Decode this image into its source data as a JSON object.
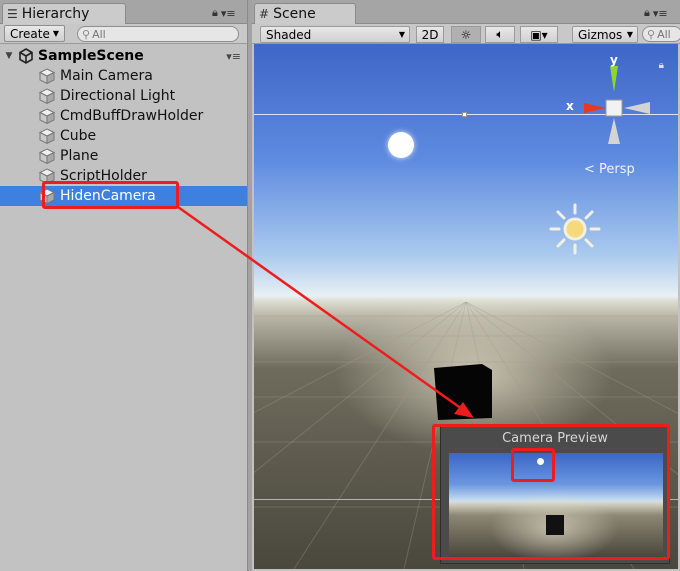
{
  "hierarchy": {
    "tab_label": "Hierarchy",
    "create_label": "Create",
    "search_placeholder": "All",
    "scene_name": "SampleScene",
    "items": [
      {
        "label": "Main Camera"
      },
      {
        "label": "Directional Light"
      },
      {
        "label": "CmdBuffDrawHolder"
      },
      {
        "label": "Cube"
      },
      {
        "label": "Plane"
      },
      {
        "label": "ScriptHolder"
      },
      {
        "label": "HidenCamera",
        "selected": true
      }
    ]
  },
  "scene": {
    "tab_label": "Scene",
    "shading_mode": "Shaded",
    "mode_2d_label": "2D",
    "gizmos_label": "Gizmos",
    "search_placeholder": "All",
    "projection_label": "Persp",
    "axis_x_label": "x",
    "axis_y_label": "y",
    "camera_preview_title": "Camera Preview"
  },
  "icons": {
    "hierarchy_tab": "list-icon",
    "scene_tab": "grid-icon",
    "lighting_toggle": "sun-icon",
    "audio_toggle": "speaker-icon",
    "effects_toggle": "image-icon",
    "search": "search-icon",
    "lock": "lock-icon",
    "panel_menu": "menu-icon"
  },
  "colors": {
    "selection": "#3d80df",
    "highlight": "#ee1c1c",
    "gizmo_x": "#e8391f",
    "gizmo_y": "#8ed62c"
  }
}
